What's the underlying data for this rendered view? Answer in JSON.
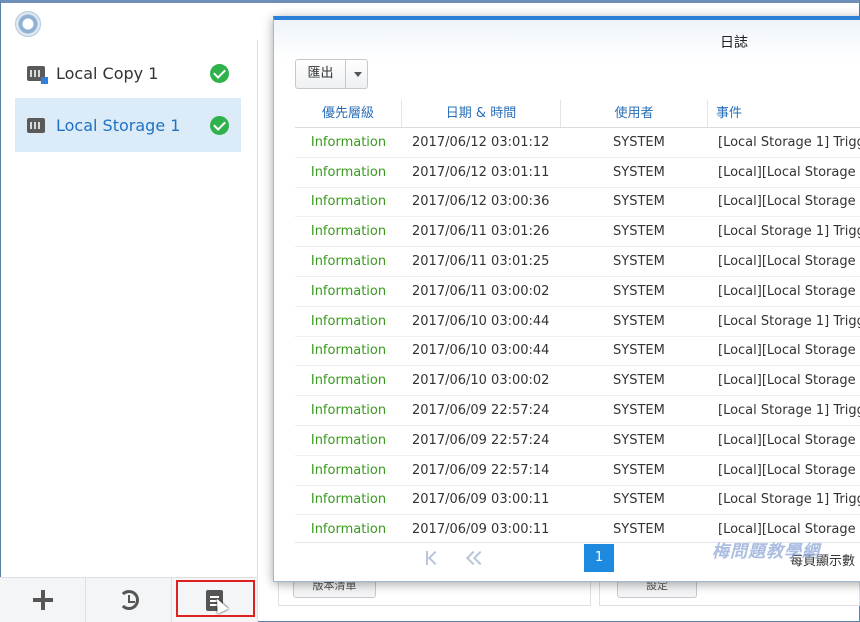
{
  "sidebar": {
    "tasks": [
      {
        "label": "Local Copy 1",
        "status": "ok"
      },
      {
        "label": "Local Storage 1",
        "status": "ok",
        "selected": true
      }
    ],
    "toolbar": [
      "plus-icon",
      "history-icon",
      "log-icon"
    ]
  },
  "background": {
    "button_1": "版本清單",
    "button_2": "設定"
  },
  "dialog": {
    "title": "日誌",
    "export_label": "匯出",
    "columns": [
      "優先層級",
      "日期 & 時間",
      "使用者",
      "事件"
    ],
    "rows": [
      {
        "priority": "Information",
        "datetime": "2017/06/12 03:01:12",
        "user": "SYSTEM",
        "event": "[Local Storage 1] Trigg"
      },
      {
        "priority": "Information",
        "datetime": "2017/06/12 03:01:11",
        "user": "SYSTEM",
        "event": "[Local][Local Storage"
      },
      {
        "priority": "Information",
        "datetime": "2017/06/12 03:00:36",
        "user": "SYSTEM",
        "event": "[Local][Local Storage"
      },
      {
        "priority": "Information",
        "datetime": "2017/06/11 03:01:26",
        "user": "SYSTEM",
        "event": "[Local Storage 1] Trigg"
      },
      {
        "priority": "Information",
        "datetime": "2017/06/11 03:01:25",
        "user": "SYSTEM",
        "event": "[Local][Local Storage"
      },
      {
        "priority": "Information",
        "datetime": "2017/06/11 03:00:02",
        "user": "SYSTEM",
        "event": "[Local][Local Storage"
      },
      {
        "priority": "Information",
        "datetime": "2017/06/10 03:00:44",
        "user": "SYSTEM",
        "event": "[Local Storage 1] Trigg"
      },
      {
        "priority": "Information",
        "datetime": "2017/06/10 03:00:44",
        "user": "SYSTEM",
        "event": "[Local][Local Storage"
      },
      {
        "priority": "Information",
        "datetime": "2017/06/10 03:00:02",
        "user": "SYSTEM",
        "event": "[Local][Local Storage"
      },
      {
        "priority": "Information",
        "datetime": "2017/06/09 22:57:24",
        "user": "SYSTEM",
        "event": "[Local Storage 1] Trigg"
      },
      {
        "priority": "Information",
        "datetime": "2017/06/09 22:57:24",
        "user": "SYSTEM",
        "event": "[Local][Local Storage"
      },
      {
        "priority": "Information",
        "datetime": "2017/06/09 22:57:14",
        "user": "SYSTEM",
        "event": "[Local][Local Storage"
      },
      {
        "priority": "Information",
        "datetime": "2017/06/09 03:00:11",
        "user": "SYSTEM",
        "event": "[Local Storage 1] Trigg"
      },
      {
        "priority": "Information",
        "datetime": "2017/06/09 03:00:11",
        "user": "SYSTEM",
        "event": "[Local][Local Storage"
      }
    ],
    "pager": {
      "current_page": "1",
      "per_page_label": "每頁顯示數"
    }
  },
  "watermark": "梅問題教學網",
  "colors": {
    "accent": "#2b80d8",
    "info_green": "#3a9a1e",
    "status_ok": "#2fb14b",
    "selected_bg": "#dcebf8",
    "highlight": "#e02020"
  }
}
